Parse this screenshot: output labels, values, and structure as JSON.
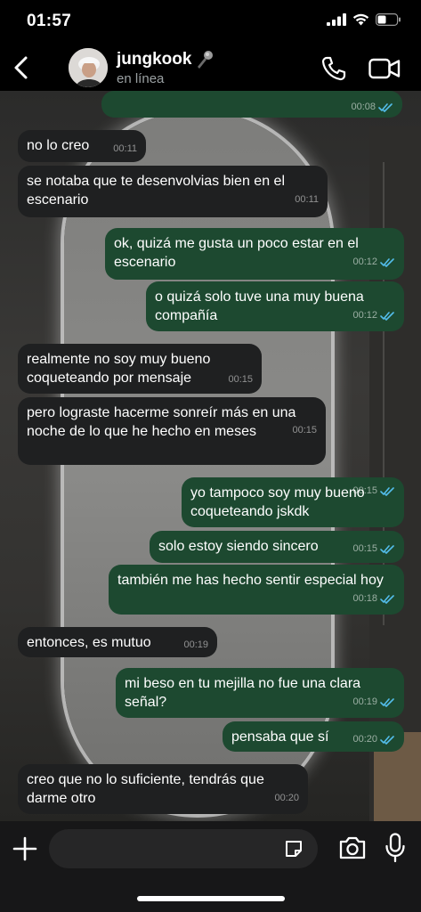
{
  "status_bar": {
    "time": "01:57"
  },
  "contact": {
    "name": "jungkook",
    "status": "en línea"
  },
  "messages": [
    {
      "dir": "out",
      "text": "",
      "time": "00:08",
      "read": true
    },
    {
      "dir": "in",
      "text": "no lo creo",
      "time": "00:11"
    },
    {
      "dir": "in",
      "text": "se notaba que te desenvolvias bien en el escenario",
      "time": "00:11"
    },
    {
      "dir": "out",
      "text": "ok, quizá me gusta un poco estar en el escenario",
      "time": "00:12",
      "read": true
    },
    {
      "dir": "out",
      "text": "o quizá solo tuve una muy buena compañía",
      "time": "00:12",
      "read": true
    },
    {
      "dir": "in",
      "text": "realmente no soy muy bueno coqueteando por mensaje",
      "time": "00:15"
    },
    {
      "dir": "in",
      "text": "pero lograste hacerme sonreír más en una noche de lo que he hecho en meses",
      "time": "00:15"
    },
    {
      "dir": "out",
      "text": "yo tampoco soy muy bueno coqueteando jskdk",
      "time": "00:15",
      "read": true
    },
    {
      "dir": "out",
      "text": "solo estoy siendo sincero",
      "time": "00:15",
      "read": true
    },
    {
      "dir": "out",
      "text": "también me has hecho sentir especial hoy",
      "time": "00:18",
      "read": true
    },
    {
      "dir": "in",
      "text": "entonces, es mutuo",
      "time": "00:19"
    },
    {
      "dir": "out",
      "text": "mi beso en tu mejilla no fue una clara señal?",
      "time": "00:19",
      "read": true
    },
    {
      "dir": "out",
      "text": "pensaba que sí",
      "time": "00:20",
      "read": true
    },
    {
      "dir": "in",
      "text": "creo que no lo suficiente, tendrás que darme otro",
      "time": "00:20"
    }
  ],
  "input": {
    "placeholder": ""
  },
  "colors": {
    "incoming_bubble": "#1f2021",
    "outgoing_bubble": "#1d4930",
    "read_tick": "#53bdeb"
  },
  "icons": [
    "back-arrow-icon",
    "microphone-emoji-icon",
    "phone-icon",
    "video-camera-icon",
    "plus-icon",
    "sticker-icon",
    "camera-icon",
    "mic-icon"
  ]
}
